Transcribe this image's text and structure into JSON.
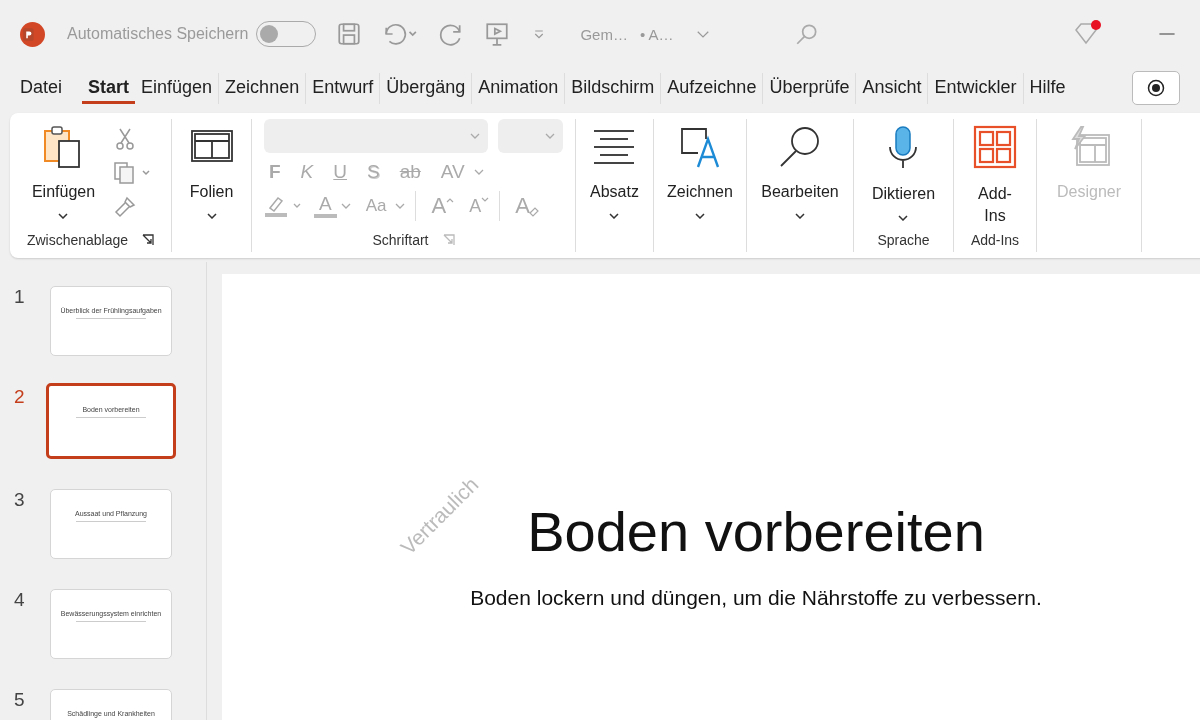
{
  "titlebar": {
    "autosave_label": "Automatisches Speichern",
    "autosave_on": false,
    "document_title": "Gem…",
    "document_location": "• A…"
  },
  "tabs": [
    {
      "label": "Datei",
      "selected": false
    },
    {
      "label": "Start",
      "selected": true
    },
    {
      "label": "Einfügen",
      "selected": false
    },
    {
      "label": "Zeichnen",
      "selected": false
    },
    {
      "label": "Entwurf",
      "selected": false
    },
    {
      "label": "Übergäng",
      "selected": false
    },
    {
      "label": "Animation",
      "selected": false
    },
    {
      "label": "Bildschirm",
      "selected": false
    },
    {
      "label": "Aufzeichne",
      "selected": false
    },
    {
      "label": "Überprüfe",
      "selected": false
    },
    {
      "label": "Ansicht",
      "selected": false
    },
    {
      "label": "Entwickler",
      "selected": false
    },
    {
      "label": "Hilfe",
      "selected": false
    }
  ],
  "ribbon": {
    "clipboard": {
      "label": "Zwischenablage",
      "paste": "Einfügen"
    },
    "slides": {
      "button": "Folien"
    },
    "font": {
      "label": "Schriftart",
      "disabled": true,
      "format_buttons": [
        "F",
        "K",
        "U",
        "S",
        "ab",
        "AV"
      ],
      "font_color_button": "A",
      "case_button": "Aa",
      "grow_button": "A",
      "shrink_button": "A",
      "clear_button": "A"
    },
    "paragraph": {
      "button": "Absatz"
    },
    "drawing": {
      "button": "Zeichnen"
    },
    "editing": {
      "button": "Bearbeiten"
    },
    "voice": {
      "button": "Diktieren",
      "label": "Sprache"
    },
    "addins": {
      "button_lines": [
        "Add-",
        "Ins"
      ],
      "label": "Add-Ins"
    },
    "designer": {
      "button": "Designer",
      "disabled": true
    }
  },
  "thumbnails": [
    {
      "number": "1",
      "title": "Überblick der Frühlingsaufgaben",
      "selected": false
    },
    {
      "number": "2",
      "title": "Boden vorbereiten",
      "selected": true
    },
    {
      "number": "3",
      "title": "Aussaat und Pflanzung",
      "selected": false
    },
    {
      "number": "4",
      "title": "Bewässerungssystem einrichten",
      "selected": false
    },
    {
      "number": "5",
      "title": "Schädlinge und Krankheiten",
      "selected": false
    }
  ],
  "slide": {
    "label": "Vertraulich",
    "title": "Boden vorbereiten",
    "subtitle": "Boden lockern und düngen, um die Nährstoffe zu verbessern."
  }
}
